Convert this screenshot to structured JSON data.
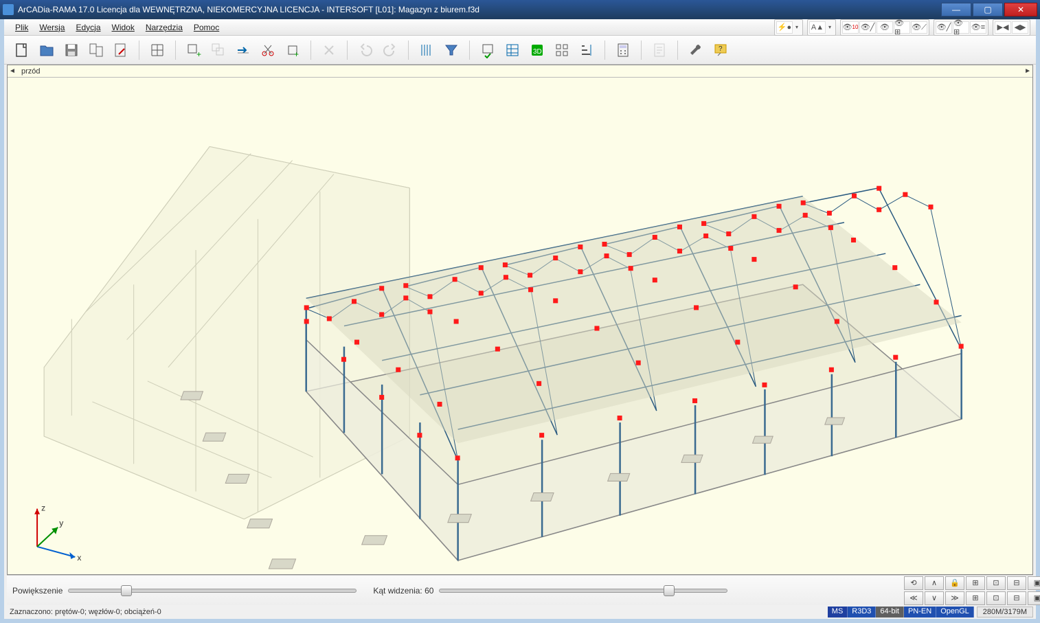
{
  "title": "ArCADia-RAMA 17.0 Licencja dla WEWNĘTRZNA, NIEKOMERCYJNA LICENCJA - INTERSOFT [L01]: Magazyn z biurem.f3d",
  "menu": {
    "plik": "Plik",
    "wersja": "Wersja",
    "edycja": "Edycja",
    "widok": "Widok",
    "narzedzia": "Narzędzia",
    "pomoc": "Pomoc"
  },
  "toolbar": {
    "new": "new",
    "open": "open",
    "save": "save",
    "save_as": "save-as",
    "export": "export",
    "grid": "grid",
    "add_node": "add-node",
    "copy": "copy",
    "move": "move",
    "cut": "cut",
    "insert_node": "insert-node",
    "delete": "delete",
    "undo": "undo",
    "redo": "redo",
    "hatch": "hatch",
    "filter": "filter",
    "check": "check",
    "table": "table",
    "view3d": "3D",
    "settings_grid": "settings-grid",
    "levels": "levels",
    "calc": "calc",
    "report": "report",
    "tools": "tools",
    "help": "help"
  },
  "right_toolbar": {
    "group1_badge": "10",
    "eye_labels": [
      "view",
      "view",
      "view",
      "view",
      "view",
      "view",
      "view",
      "view",
      "view"
    ]
  },
  "viewport": {
    "label": "przód",
    "axis_x": "x",
    "axis_y": "y",
    "axis_z": "z"
  },
  "bottom": {
    "zoom_label": "Powiększenie",
    "zoom_value_pct": 18,
    "fov_label": "Kąt widzenia: 60",
    "fov_value_pct": 78
  },
  "nav": {
    "r1": [
      "⟲",
      "∧",
      "🔒",
      "⊞",
      "⊡",
      "⊟",
      "▣"
    ],
    "r2": [
      "≪",
      "∨",
      "≫",
      "⊞",
      "⊡",
      "⊟",
      "▣"
    ]
  },
  "status": {
    "left": "Zaznaczono: prętów-0; węzłów-0; obciążeń-0",
    "ms": "MS",
    "r3d3": "R3D3",
    "bit": "64-bit",
    "pn": "PN-EN",
    "ogl": "OpenGL",
    "mem": "280M/3179M"
  }
}
